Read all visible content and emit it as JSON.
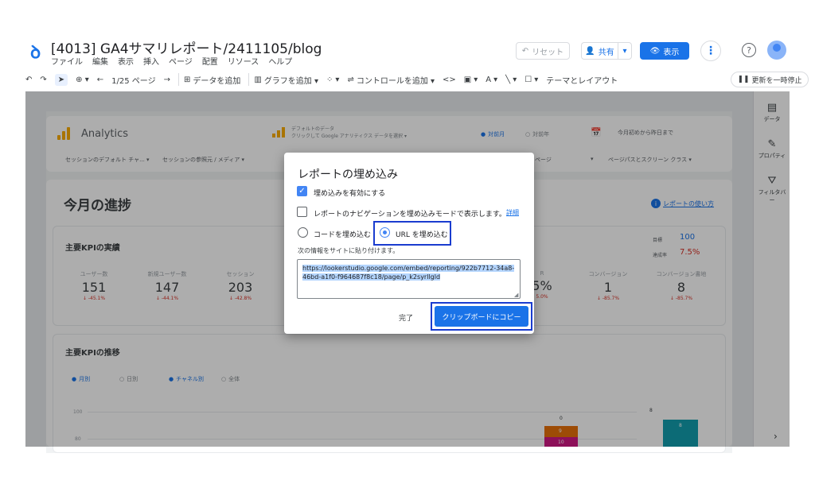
{
  "app": {
    "title": "[4013] GA4サマリレポート/2411105/blog",
    "menus": [
      "ファイル",
      "編集",
      "表示",
      "挿入",
      "ページ",
      "配置",
      "リソース",
      "ヘルプ"
    ],
    "reset": "リセット",
    "share": "共有",
    "view": "表示",
    "help": "?"
  },
  "toolbar": {
    "undo": "↶",
    "redo": "↷",
    "pointer": "➤",
    "zoom": "⊕ ▾",
    "page_indicator": "1/25 ページ",
    "add_data": "データを追加",
    "add_chart": "グラフを追加 ▾",
    "community": "▾",
    "add_control": "コントロールを追加 ▾",
    "code": "<>",
    "image": "▾",
    "text": "▾",
    "line": "▾",
    "shape": "▾",
    "theme": "テーマとレイアウト",
    "pause": "更新を一時停止"
  },
  "report": {
    "brand": "Analytics",
    "datasource_line1": "デフォルトのデータ",
    "datasource_line2": "クリックして Google アナリティクス データを選択",
    "datasource_arrow": "▾",
    "compare_prev_month": "対前月",
    "compare_prev_year": "対前年",
    "date_range": "今月初めから昨日まで",
    "filters": [
      "セッションのデフォルト チャ... ▾",
      "セッションの参照元 / メディア ▾",
      "ページ",
      "▾",
      "ページパスとスクリーン クラス ▾"
    ],
    "progress_title": "今月の進捗",
    "usage_link": "レポートの使い方",
    "kpi_title": "主要KPIの実績",
    "goal_label": "目標",
    "goal_value": "100",
    "rate_label": "達成率",
    "rate_value": "7.5%",
    "metrics": [
      {
        "label": "ユーザー数",
        "value": "151",
        "delta": "↓ -45.1%"
      },
      {
        "label": "新規ユーザー数",
        "value": "147",
        "delta": "↓ -44.1%"
      },
      {
        "label": "セッション",
        "value": "203",
        "delta": "↓ -42.8%"
      },
      {
        "label": "R",
        "value": "5%",
        "delta": "5.0%"
      },
      {
        "label": "コンバージョン",
        "value": "1",
        "delta": "↓ -85.7%"
      },
      {
        "label": "コンバージョン書地",
        "value": "8",
        "delta": "↓ -85.7%"
      }
    ],
    "trend_title": "主要KPIの推移",
    "trend_options": [
      "月別",
      "日別",
      "チャネル別",
      "全体"
    ],
    "axis_100": "100",
    "axis_80": "80",
    "bar_top_label": "0",
    "bar_a_label": "9",
    "bar_b_label": "10",
    "bar_c_top_label": "8",
    "bar_c_label": "8"
  },
  "side_panel": {
    "items": [
      {
        "icon": "▤",
        "label": "データ"
      },
      {
        "icon": "✎",
        "label": "プロパティ"
      },
      {
        "icon": "⛛",
        "label": "フィルタバー"
      }
    ],
    "chevron": "›"
  },
  "dialog": {
    "title": "レポートの埋め込み",
    "enable_embed": "埋め込みを有効にする",
    "show_navigation": "レポートのナビゲーションを埋め込みモードで表示します。",
    "detail_link": "詳細",
    "embed_code": "コードを埋め込む",
    "embed_url": "URL を埋め込む",
    "instruction": "次の情報をサイトに貼り付けます。",
    "url_value": "https://lookerstudio.google.com/embed/reporting/922b7712-34a8-46bd-a1f0-f964687f8c18/page/p_k2syrllgld",
    "done": "完了",
    "copy": "クリップボードにコピー"
  },
  "colors": {
    "accent": "#1a73e8",
    "highlight_box": "#1a3ccf",
    "negative": "#d93025",
    "ga_orange": "#f9ab00"
  }
}
